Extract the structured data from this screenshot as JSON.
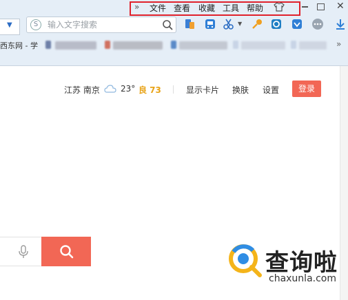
{
  "menu": {
    "chevron": "»",
    "items": [
      "文件",
      "查看",
      "收藏",
      "工具",
      "帮助"
    ],
    "skin_icon": "shirt-icon"
  },
  "window_controls": {
    "minimize": "—",
    "maximize": "□",
    "close": "✕"
  },
  "toolbar": {
    "search_placeholder": "输入文字搜索",
    "search_logo": "S",
    "icons": [
      "phone-sync-icon",
      "translate-icon",
      "scissors-icon",
      "key-icon",
      "reader-icon",
      "shield-icon",
      "more-icon",
      "download-icon"
    ]
  },
  "bookmarks": {
    "first_label": "西东网 - 学",
    "more": "»"
  },
  "page": {
    "location": "江苏 南京",
    "temperature": "23°",
    "aqi_label": "良 73",
    "show_card": "显示卡片",
    "skin": "换肤",
    "settings": "设置",
    "login": "登录"
  },
  "watermark": {
    "text": "查询啦",
    "url": "chaxunla.com"
  },
  "colors": {
    "highlight_border": "#e0202a",
    "accent": "#f26755",
    "aqi": "#e8a317"
  }
}
